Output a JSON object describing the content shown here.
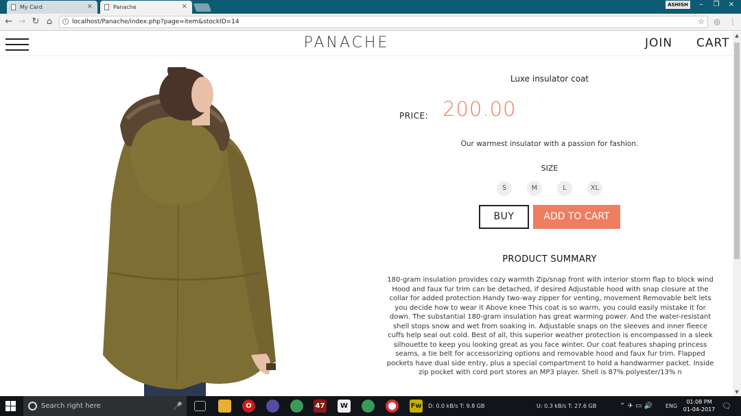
{
  "browser": {
    "tabs": [
      {
        "title": "My Card",
        "close": "×"
      },
      {
        "title": "Panache",
        "close": "×"
      }
    ],
    "user_badge": "ASHISH",
    "window_buttons": {
      "minimize": "–",
      "restore": "❐",
      "close": "×"
    },
    "nav": {
      "back": "←",
      "forward": "→",
      "reload": "↻",
      "home": "⌂"
    },
    "url": "localhost/Panache/index.php?page=item&stockID=14",
    "star": "☆"
  },
  "site": {
    "logo": "PANACHE",
    "join": "JOIN",
    "cart": "CART"
  },
  "product": {
    "name": "Luxe insulator coat",
    "price_label": "PRICE:",
    "price": "200.00",
    "tagline": "Our warmest insulator with a passion for fashion.",
    "size_label": "SIZE",
    "sizes": [
      "S",
      "M",
      "L",
      "XL"
    ],
    "buy_label": "BUY",
    "add_to_cart_label": "ADD TO CART",
    "summary_title": "PRODUCT SUMMARY",
    "summary": "180-gram insulation provides cozy warmth Zip/snap front with interior storm flap to block wind Hood and faux fur trim can be detached, if desired Adjustable hood with snap closure at the collar for added protection Handy two-way zipper for venting, movement Removable belt lets you decide how to wear it Above knee This coat is so warm, you could easily mistake it for down. The substantial 180-gram insulation has great warming power. And the water-resistant shell stops snow and wet from soaking in. Adjustable snaps on the sleeves and inner fleece cuffs help seal out cold. Best of all, this superior weather protection is encompassed in a sleek silhouette to keep you looking great as you face winter. Our coat features shaping princess seams, a tie belt for accessorizing options and removable hood and faux fur trim. Flapped pockets have dual side entry, plus a special compartment to hold a handwarmer packet. Inside zip pocket with cord port stores an MP3 player. Shell is 87% polyester/13% n"
  },
  "taskbar": {
    "search_placeholder": "Search right here",
    "badge_47": "47",
    "net_down": "D: 0.0 kB/s T: 9.8 GB",
    "net_up": "U: 0.3 kB/s T: 27.6 GB",
    "language": "ENG",
    "time": "01:08 PM",
    "date": "01-04-2017"
  },
  "colors": {
    "accent": "#ef7d60",
    "price": "#ee7a5a",
    "tabstrip": "#0d5c74",
    "coat": "#7d6e34"
  }
}
